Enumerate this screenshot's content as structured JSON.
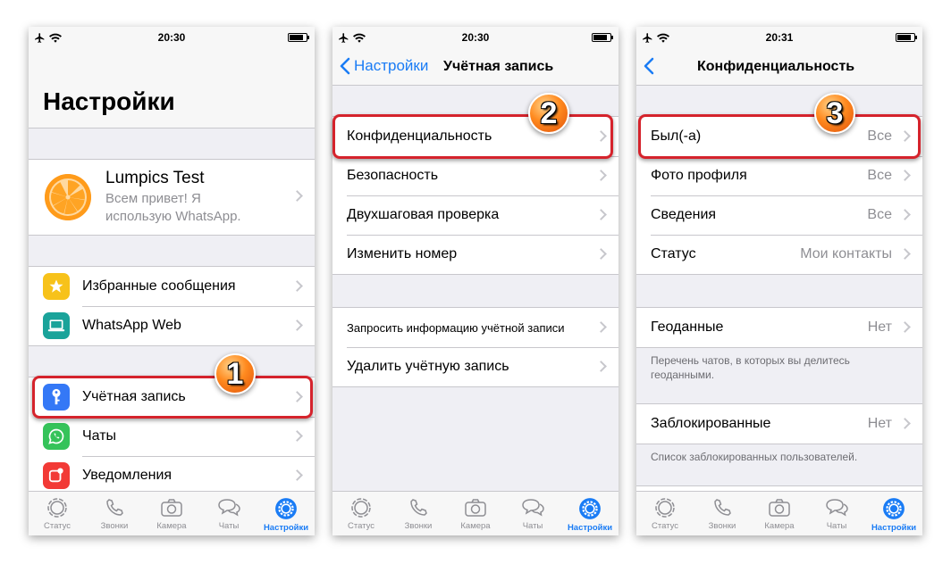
{
  "screens": [
    {
      "time": "20:30",
      "title": "Настройки",
      "profile": {
        "name": "Lumpics Test",
        "status_line1": "Всем привет! Я",
        "status_line2": "использую WhatsApp."
      },
      "menu_group1": [
        {
          "label": "Избранные сообщения",
          "icon": "star-icon",
          "color": "#f7c21a"
        },
        {
          "label": "WhatsApp Web",
          "icon": "laptop-icon",
          "color": "#1aa39a"
        }
      ],
      "menu_group2": [
        {
          "label": "Учётная запись",
          "icon": "key-icon",
          "color": "#3478f6"
        },
        {
          "label": "Чаты",
          "icon": "whatsapp-icon",
          "color": "#35c35a"
        },
        {
          "label": "Уведомления",
          "icon": "notification-icon",
          "color": "#f23a36"
        }
      ],
      "step": "1"
    },
    {
      "time": "20:30",
      "back_label": "Настройки",
      "title": "Учётная запись",
      "group1": [
        "Конфиденциальность",
        "Безопасность",
        "Двухшаговая проверка",
        "Изменить номер"
      ],
      "group2": [
        "Запросить информацию учётной записи",
        "Удалить учётную запись"
      ],
      "step": "2"
    },
    {
      "time": "20:31",
      "title": "Конфиденциальность",
      "group1": [
        {
          "label": "Был(-а)",
          "value": "Все"
        },
        {
          "label": "Фото профиля",
          "value": "Все"
        },
        {
          "label": "Сведения",
          "value": "Все"
        },
        {
          "label": "Статус",
          "value": "Мои контакты"
        }
      ],
      "geo": {
        "label": "Геоданные",
        "value": "Нет",
        "note": "Перечень чатов, в которых вы делитесь геоданными."
      },
      "blocked": {
        "label": "Заблокированные",
        "value": "Нет",
        "note": "Список заблокированных пользователей."
      },
      "step": "3"
    }
  ],
  "tabs": [
    "Статус",
    "Звонки",
    "Камера",
    "Чаты",
    "Настройки"
  ],
  "active_tab": "Настройки",
  "colors": {
    "accent": "#1a7cf5",
    "highlight": "#d5232c",
    "badge": "#ff8a1f"
  }
}
